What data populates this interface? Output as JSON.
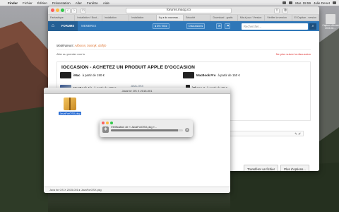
{
  "menubar": {
    "apple": "",
    "items": [
      "Finder",
      "Fichier",
      "Édition",
      "Présentation",
      "Aller",
      "Fenêtre",
      "Aide"
    ],
    "time": "Mar. 15:59",
    "user": "Julie Denet"
  },
  "browser": {
    "url": "forums.macg.co",
    "tabs": [
      "Fantastique",
      "Installation / Boot...",
      "Installation",
      "Installation",
      "Il y a du nouveau...",
      "Sécurité",
      "Download - gratis",
      "Mis à jour / Version",
      "Vérifier la version",
      "El Capitan - version"
    ],
    "site": {
      "nav": {
        "forum": "FORUMS",
        "members": "MEMBRES"
      },
      "pager": "◂ 39 / 56 ▸",
      "chip_discussions": "Discussions",
      "search_placeholder": "Rechercher...",
      "moderators_label": "Modérateurs:",
      "moderators": "Aliboron, boninjk, daffyb",
      "breadcrumb": "Aller au premier non lu",
      "not_read": "Ne plus suivre la discussion",
      "promo": {
        "title": "IOCCASION - ACHETEZ UN PRODUIT APPLE D'OCCASION",
        "products": [
          {
            "name": "iMac",
            "price": "à partir de 190 €"
          },
          {
            "name": "MacBook Pro",
            "price": "à partir de 150 €"
          },
          {
            "name": "MacBook Air",
            "price": "à partir de 180 €"
          },
          {
            "name": "iPhone 4",
            "price": "à partir de 80 €"
          }
        ]
      },
      "buttons": {
        "transfer": "Transférer un fichier",
        "more": "Plus d'options..."
      },
      "reply_edit_icon": "pencil-icon"
    }
  },
  "finder": {
    "title": "Java for OS X 2015-001",
    "behind_title": "JAVA-OSX",
    "file": "JavaForOSX.pkg",
    "status_path": "Java for OS X 2015-001  ▸  JavaForOSX.pkg"
  },
  "dialog": {
    "text": "Vérification de « JavaForOSX.pkg »...",
    "progress": 0.93
  },
  "desktop_file": {
    "label": "Capture d'écran 2015-02-..."
  }
}
